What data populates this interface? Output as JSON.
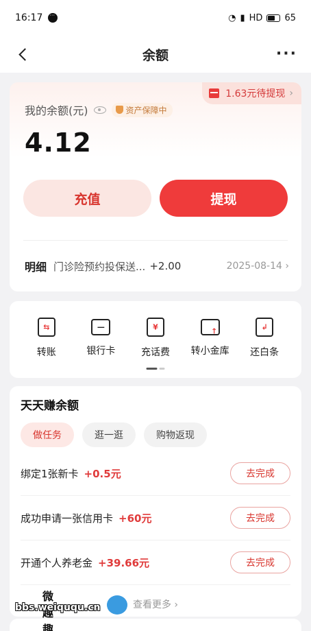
{
  "status_bar": {
    "time": "16:17",
    "network": "HD",
    "battery": "65",
    "battery_level": 0.65
  },
  "nav": {
    "title": "余额"
  },
  "balance": {
    "pending_label": "1.63元待提现",
    "label": "我的余额(元)",
    "guard_label": "资产保障中",
    "amount": "4.12",
    "recharge_label": "充值",
    "withdraw_label": "提现",
    "detail": {
      "head": "明细",
      "desc": "门诊险预约投保送...",
      "amount": "+2.00",
      "date": "2025-08-14"
    }
  },
  "tools": [
    {
      "label": "转账",
      "icon": "transfer-icon"
    },
    {
      "label": "银行卡",
      "icon": "bank-card-icon"
    },
    {
      "label": "充话费",
      "icon": "phone-recharge-icon"
    },
    {
      "label": "转小金库",
      "icon": "vault-icon"
    },
    {
      "label": "还白条",
      "icon": "repay-icon"
    }
  ],
  "earn": {
    "title": "天天赚余额",
    "tabs": [
      "做任务",
      "逛一逛",
      "购物返现"
    ],
    "active_tab": 0,
    "tasks": [
      {
        "title": "绑定1张新卡",
        "reward": "+0.5元",
        "action": "去完成"
      },
      {
        "title": "成功申请一张信用卡",
        "reward": "+60元",
        "action": "去完成"
      },
      {
        "title": "开通个人养老金",
        "reward": "+39.66元",
        "action": "去完成"
      }
    ],
    "see_more": "查看更多"
  },
  "watermark": {
    "brand": "微趣趣",
    "url": "bbs.weiququ.cn"
  },
  "colors": {
    "accent": "#ef3b3b",
    "accent_light": "#fbe6e2",
    "background": "#f2f2f4"
  }
}
